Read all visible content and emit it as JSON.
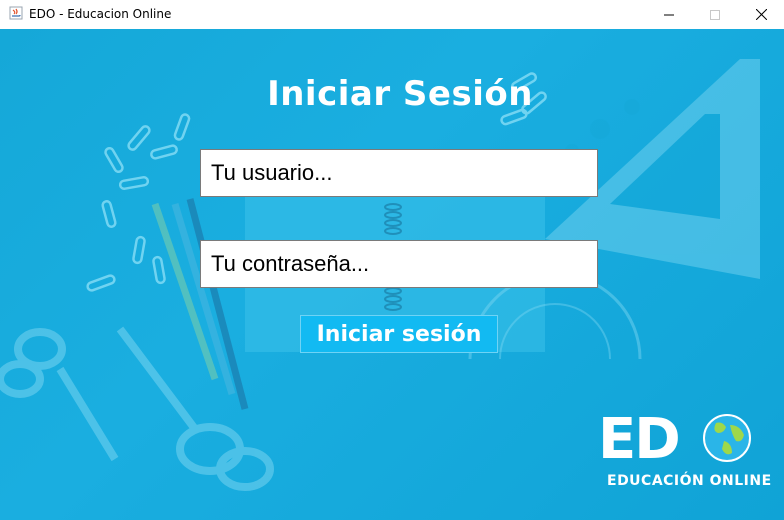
{
  "window": {
    "title": "EDO - Educacion Online",
    "controls": [
      "minimize",
      "maximize",
      "close"
    ]
  },
  "login": {
    "heading": "Iniciar Sesión",
    "username_placeholder": "Tu usuario...",
    "password_placeholder": "Tu contraseña...",
    "submit_label": "Iniciar sesión"
  },
  "logo": {
    "letters": "ED",
    "tagline": "EDUCACIÓN ONLINE",
    "icon": "globe-icon"
  },
  "colors": {
    "background": "#15a8d8",
    "button": "#12baf2",
    "text_light": "#ffffff"
  }
}
